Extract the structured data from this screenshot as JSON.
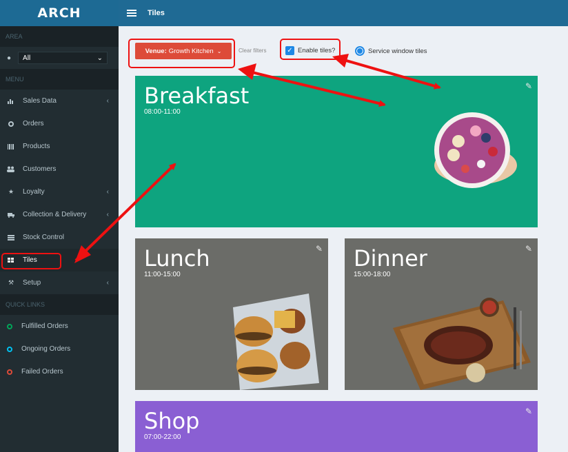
{
  "brand": {
    "name": "ARCH"
  },
  "topbar": {
    "title": "Tiles"
  },
  "sidebar": {
    "area_header": "AREA",
    "area_value": "All",
    "menu_header": "MENU",
    "items": [
      {
        "label": "Sales Data",
        "icon": "bar-chart-icon"
      },
      {
        "label": "Orders",
        "icon": "circle-icon"
      },
      {
        "label": "Products",
        "icon": "barcode-icon"
      },
      {
        "label": "Customers",
        "icon": "users-icon"
      },
      {
        "label": "Loyalty",
        "icon": "star-icon"
      },
      {
        "label": "Collection & Delivery",
        "icon": "truck-icon"
      },
      {
        "label": "Stock Control",
        "icon": "list-icon"
      },
      {
        "label": "Tiles",
        "icon": "grid-icon"
      },
      {
        "label": "Setup",
        "icon": "wrench-icon"
      }
    ],
    "quick_links_header": "QUICK LINKS",
    "quick_links": [
      {
        "label": "Fulfilled Orders",
        "color": "#00a65a"
      },
      {
        "label": "Ongoing Orders",
        "color": "#00c0ef"
      },
      {
        "label": "Failed Orders",
        "color": "#dd4b39"
      }
    ]
  },
  "toolbar": {
    "venue_prefix": "Venue:",
    "venue_value": "Growth Kitchen",
    "clear_filters": "Clear filters",
    "enable_tiles": "Enable tiles?",
    "service_window": "Service window tiles"
  },
  "tiles": [
    {
      "title": "Breakfast",
      "time": "08:00-11:00",
      "color": "#0ea47f"
    },
    {
      "title": "Lunch",
      "time": "11:00-15:00",
      "color": "#6b6c68"
    },
    {
      "title": "Dinner",
      "time": "15:00-18:00",
      "color": "#6b6c68"
    },
    {
      "title": "Shop",
      "time": "07:00-22:00",
      "color": "#8a5fd3"
    }
  ]
}
